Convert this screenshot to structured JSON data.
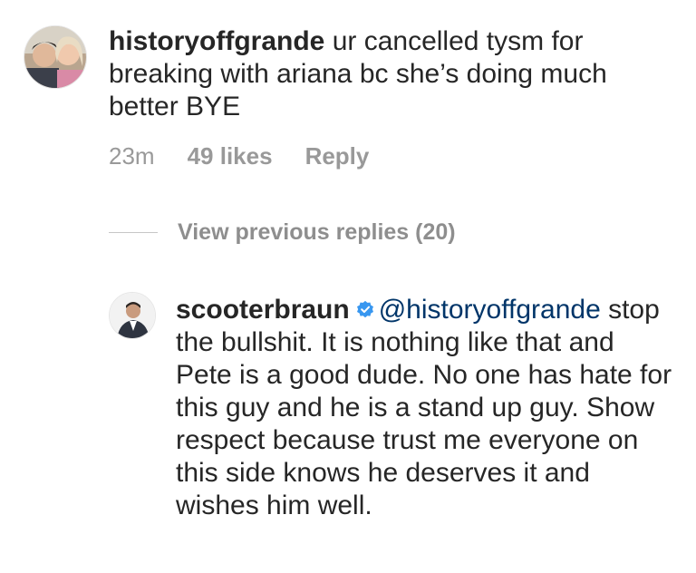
{
  "comment1": {
    "username": "historyoffgrande",
    "text": " ur cancelled tysm for breaking with ariana bc she’s doing much better BYE",
    "time": "23m",
    "likes": "49 likes",
    "reply_label": "Reply"
  },
  "view_replies": {
    "label": "View previous replies (20)"
  },
  "comment2": {
    "username": "scooterbraun",
    "mention": "@historyoffgrande",
    "text": " stop the bullshit. It is nothing like that and Pete is a good dude. No one has hate for this guy and he is a stand up guy. Show respect because trust me everyone on this side knows he deserves it and wishes him well."
  },
  "colors": {
    "verified_badge": "#3897f0",
    "muted_text": "#999999",
    "mention": "#003569"
  },
  "icons": {
    "verified": "verified-badge-icon"
  }
}
